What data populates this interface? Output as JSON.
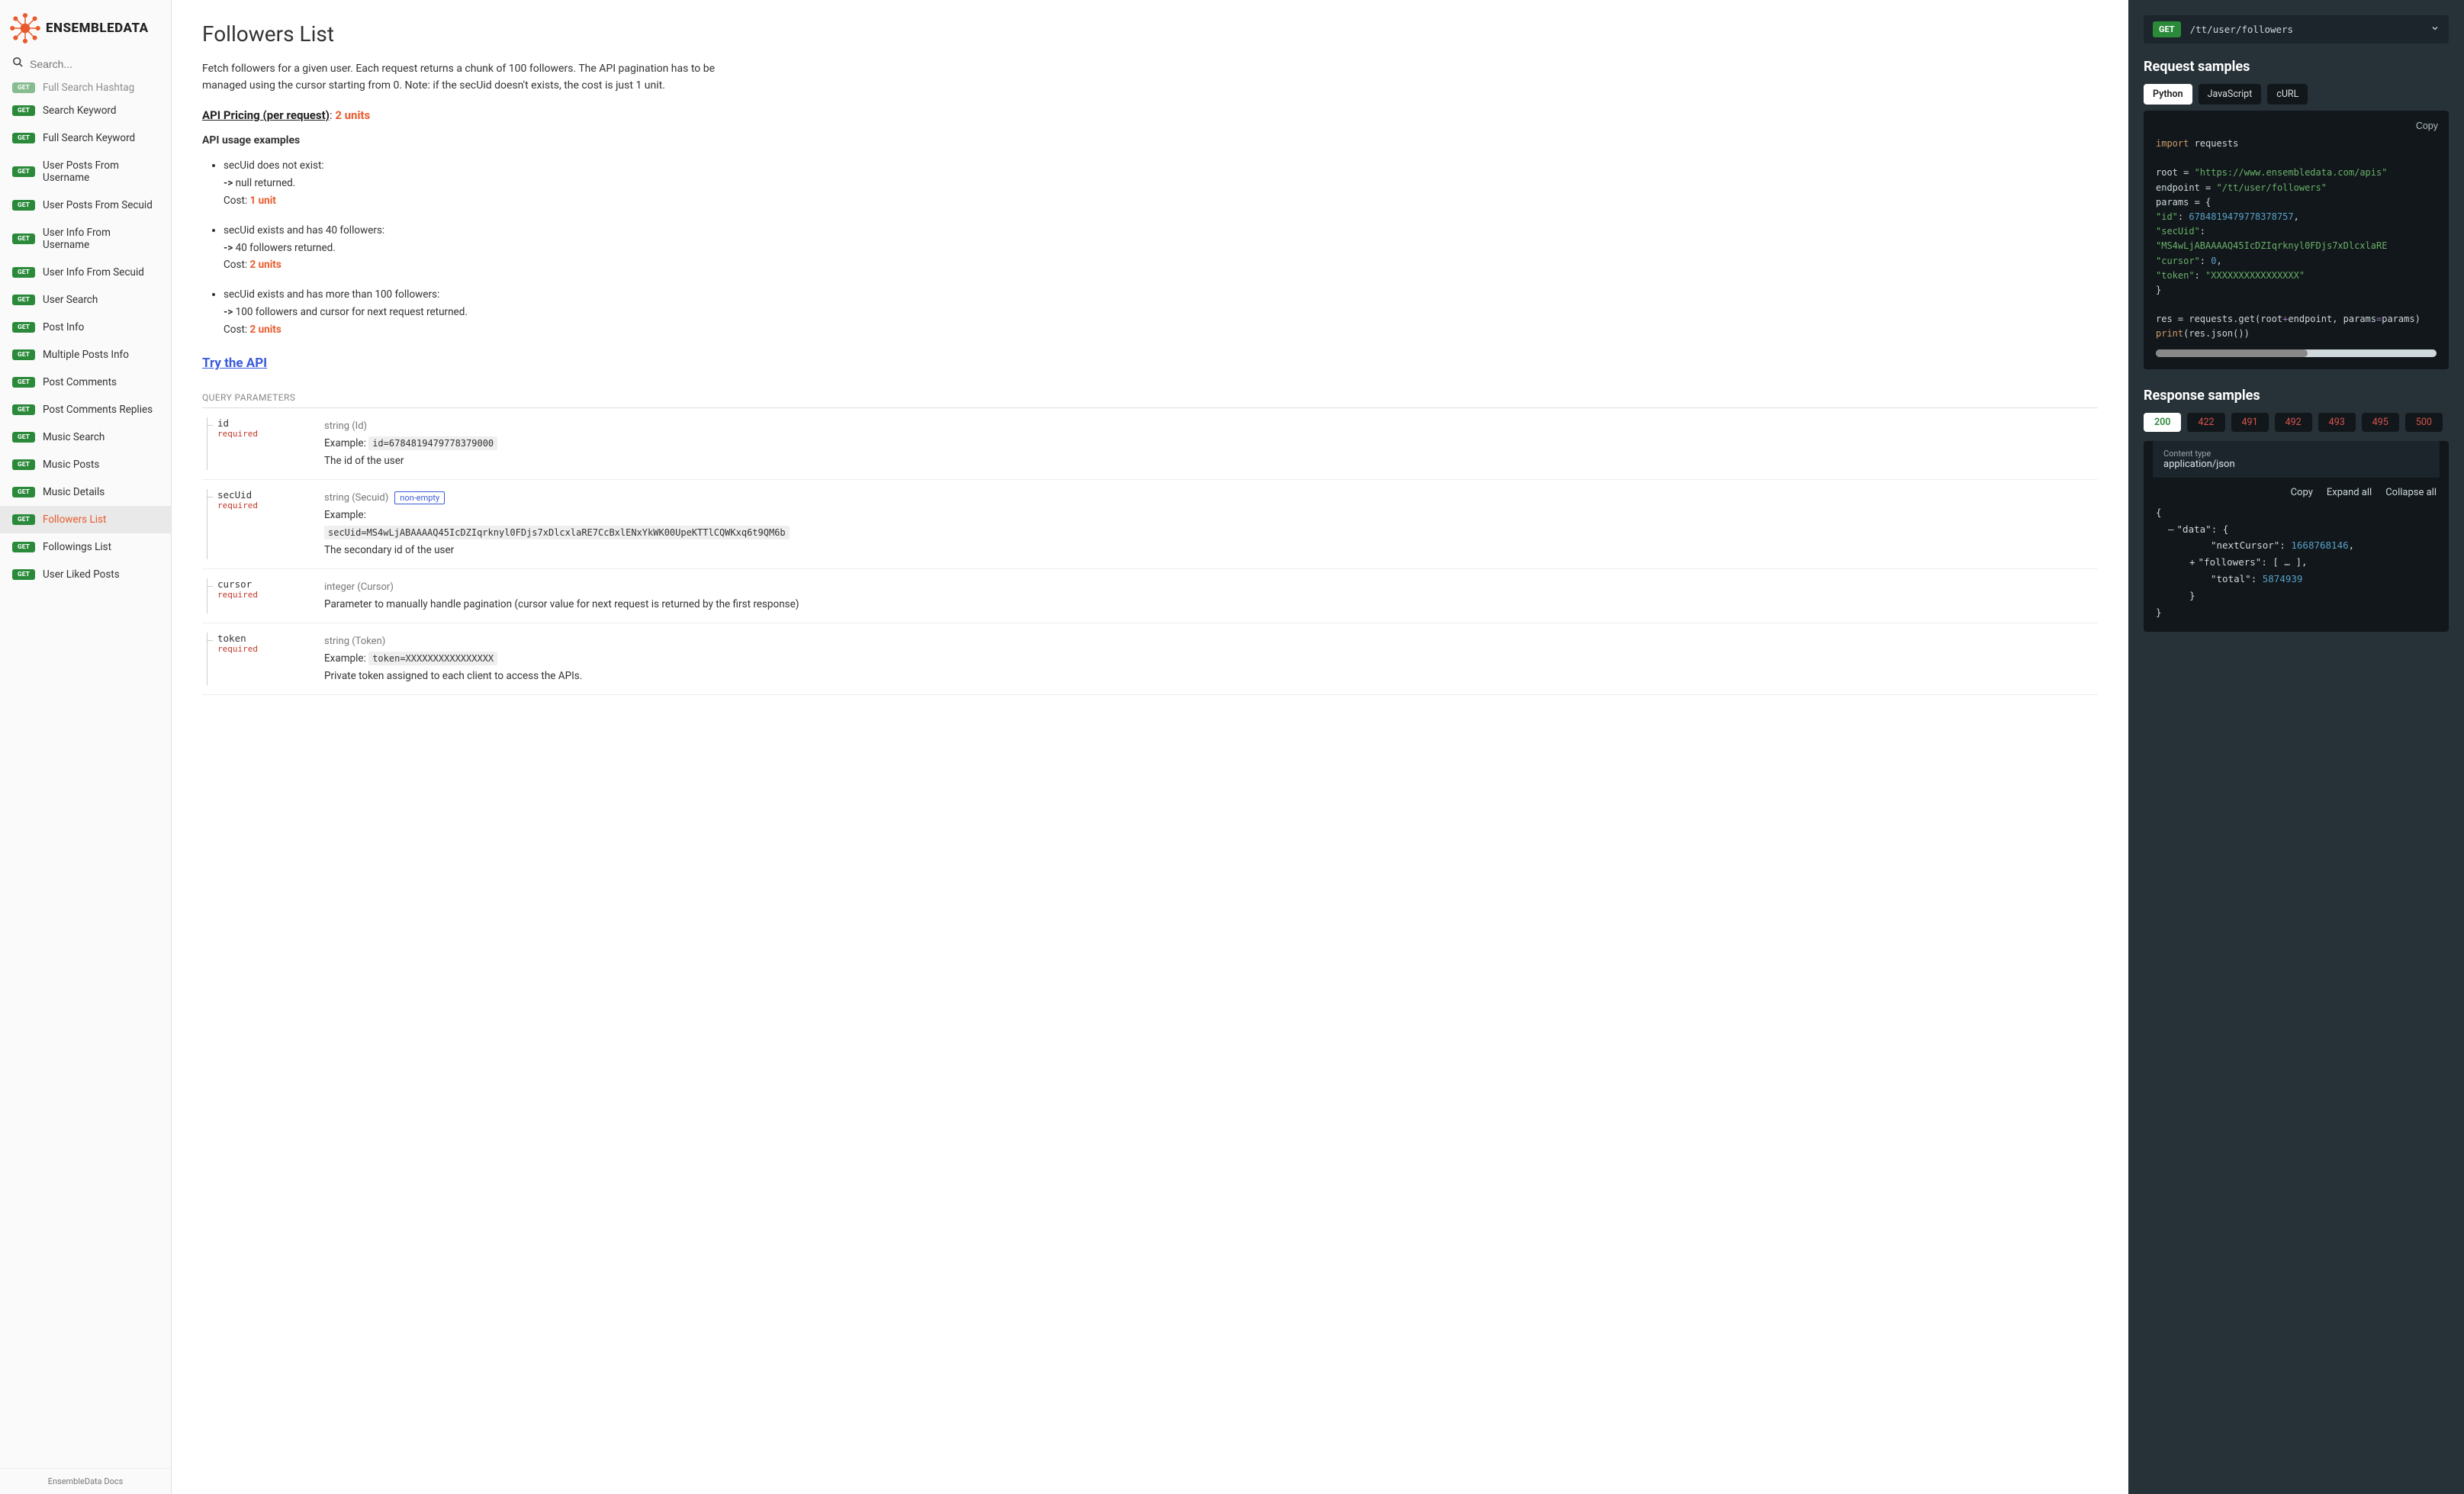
{
  "brand": {
    "name": "ENSEMBLEDATA"
  },
  "search": {
    "placeholder": "Search..."
  },
  "sidebar": {
    "top_cut_item": "Full Search Hashtag",
    "items": [
      {
        "label": "Search Keyword"
      },
      {
        "label": "Full Search Keyword"
      },
      {
        "label": "User Posts From Username"
      },
      {
        "label": "User Posts From Secuid"
      },
      {
        "label": "User Info From Username"
      },
      {
        "label": "User Info From Secuid"
      },
      {
        "label": "User Search"
      },
      {
        "label": "Post Info"
      },
      {
        "label": "Multiple Posts Info"
      },
      {
        "label": "Post Comments"
      },
      {
        "label": "Post Comments Replies"
      },
      {
        "label": "Music Search"
      },
      {
        "label": "Music Posts"
      },
      {
        "label": "Music Details"
      },
      {
        "label": "Followers List",
        "active": true
      },
      {
        "label": "Followings List"
      },
      {
        "label": "User Liked Posts"
      }
    ],
    "footer": "EnsembleData Docs"
  },
  "page": {
    "title": "Followers List",
    "description": "Fetch followers for a given user. Each request returns a chunk of 100 followers. The API pagination has to be managed using the cursor starting from 0. Note: if the secUid doesn't exists, the cost is just 1 unit.",
    "pricing_label": "API Pricing (per request)",
    "pricing_sep": ": ",
    "pricing_units": "2 ",
    "pricing_units_word": "units",
    "usage_heading": "API usage examples",
    "examples": [
      {
        "title": "secUid does not exist:",
        "result": "null returned.",
        "cost_label": "Cost: ",
        "cost": "1 unit"
      },
      {
        "title": "secUid exists and has 40 followers:",
        "result": "40 followers returned.",
        "cost_label": "Cost: ",
        "cost": "2 units"
      },
      {
        "title": "secUid exists and has more than 100 followers:",
        "result": "100 followers and cursor for next request returned.",
        "cost_label": "Cost: ",
        "cost": "2 units"
      }
    ],
    "try_label": "Try the API",
    "query_params_heading": "QUERY PARAMETERS",
    "required_word": "required"
  },
  "params": [
    {
      "name": "id",
      "type": "string (Id)",
      "example_label": "Example: ",
      "example": "id=6784819479778379000",
      "desc": "The id of the user"
    },
    {
      "name": "secUid",
      "type": "string (Secuid)",
      "nonempty": "non-empty",
      "example_label": "Example:",
      "example": "secUid=MS4wLjABAAAAQ45IcDZIqrknyl0FDjs7xDlcxlaRE7CcBxlENxYkWK00UpeKTTlCQWKxq6t9QM6b",
      "desc": "The secondary id of the user"
    },
    {
      "name": "cursor",
      "type": "integer (Cursor)",
      "desc": "Parameter to manually handle pagination (cursor value for next request is returned by the first response)"
    },
    {
      "name": "token",
      "type": "string (Token)",
      "example_label": "Example: ",
      "example": "token=XXXXXXXXXXXXXXXX",
      "desc": "Private token assigned to each client to access the APIs."
    }
  ],
  "rhs": {
    "method": "GET",
    "path": "/tt/user/followers",
    "request_heading": "Request samples",
    "tabs": [
      "Python",
      "JavaScript",
      "cURL"
    ],
    "copy_label": "Copy",
    "code": {
      "l1a": "import",
      "l1b": " requests",
      "l2a": "root = ",
      "l2b": "\"https://www.ensembledata.com/apis\"",
      "l3a": "endpoint = ",
      "l3b": "\"/tt/user/followers\"",
      "l4": "params = {",
      "l5a": "    \"id\"",
      "l5b": ": ",
      "l5c": "6784819479778378757",
      "l5d": ",",
      "l6a": "    \"secUid\"",
      "l6b": ": ",
      "l6c": "\"MS4wLjABAAAAQ45IcDZIqrknyl0FDjs7xDlcxlaRE",
      "l6d": "",
      "l7a": "    \"cursor\"",
      "l7b": ": ",
      "l7c": "0",
      "l7d": ",",
      "l8a": "    \"token\"",
      "l8b": ": ",
      "l8c": "\"XXXXXXXXXXXXXXXX\"",
      "l9": "}",
      "l10a": "res = requests.get(root",
      "l10b": "+",
      "l10c": "endpoint, params",
      "l10d": "=",
      "l10e": "params)",
      "l11a": "print",
      "l11b": "(res.json())"
    },
    "response_heading": "Response samples",
    "statuses": [
      "200",
      "422",
      "491",
      "492",
      "493",
      "495",
      "500"
    ],
    "content_type_label": "Content type",
    "content_type_value": "application/json",
    "json_tools": {
      "copy": "Copy",
      "expand": "Expand all",
      "collapse": "Collapse all"
    },
    "json": {
      "open": "{",
      "data_key": "\"data\"",
      "data_open": ": {",
      "nc_key": "\"nextCursor\"",
      "nc_val": "1668768146",
      "comma": ",",
      "fol_key": "\"followers\"",
      "fol_val": ": [ … ],",
      "tot_key": "\"total\"",
      "tot_val": "5874939",
      "close_inner": "}",
      "close": "}"
    }
  }
}
